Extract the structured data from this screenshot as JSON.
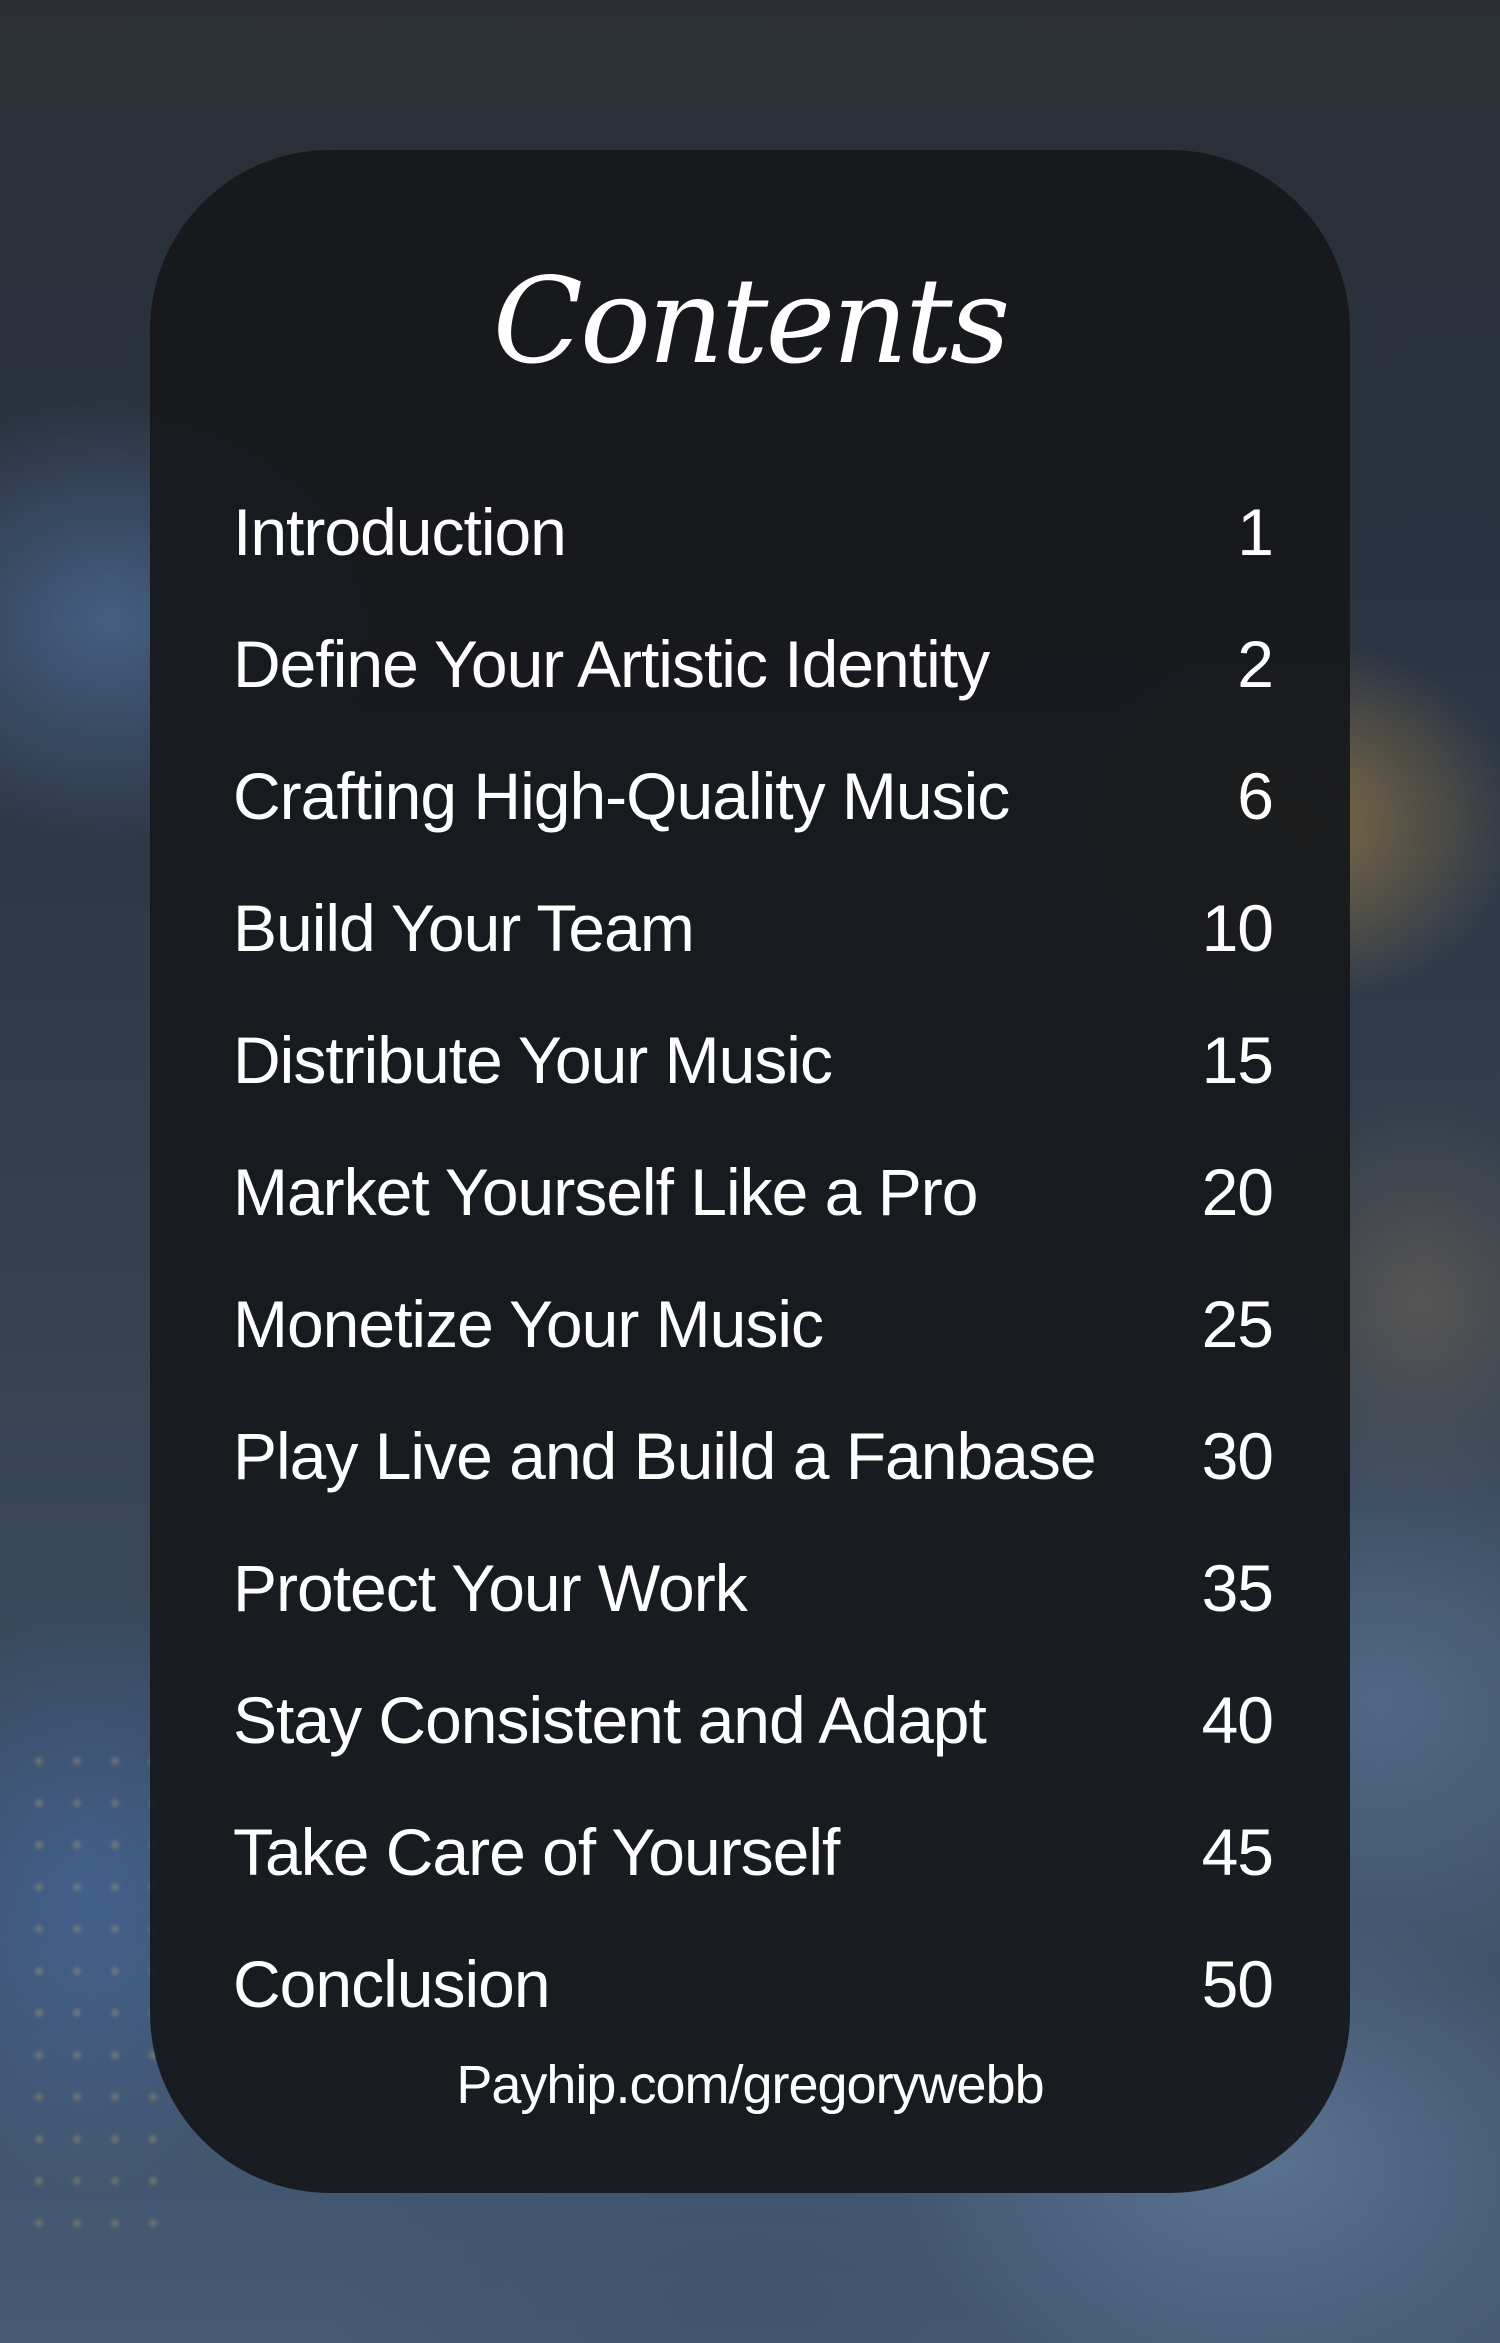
{
  "title": "Contents",
  "entries": [
    {
      "label": "Introduction",
      "page": "1"
    },
    {
      "label": "Define Your Artistic Identity",
      "page": "2"
    },
    {
      "label": "Crafting High-Quality Music",
      "page": "6"
    },
    {
      "label": "Build Your Team",
      "page": "10"
    },
    {
      "label": "Distribute Your Music",
      "page": "15"
    },
    {
      "label": "Market Yourself Like a Pro",
      "page": "20"
    },
    {
      "label": "Monetize Your Music",
      "page": "25"
    },
    {
      "label": "Play Live and Build a Fanbase",
      "page": "30"
    },
    {
      "label": "Protect Your Work",
      "page": "35"
    },
    {
      "label": "Stay Consistent and Adapt",
      "page": "40"
    },
    {
      "label": "Take Care of Yourself",
      "page": "45"
    },
    {
      "label": "Conclusion",
      "page": "50"
    }
  ],
  "footer": "Payhip.com/gregorywebb"
}
